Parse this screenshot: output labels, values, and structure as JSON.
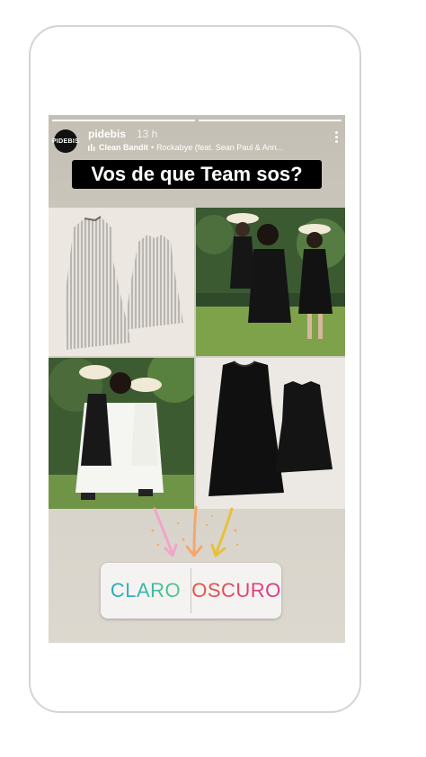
{
  "story": {
    "username": "pidebis",
    "time": "13 h",
    "avatar_text": "PIDEBIS",
    "music": {
      "artist": "Clean Bandit",
      "song": "Rockabye (feat. Sean Paul & Ann..."
    },
    "question": "Vos de que Team sos?",
    "poll": {
      "option_left": "CLARO",
      "option_right": "OSCURO"
    },
    "colors": {
      "claro_gradient": [
        "#2aa7c7",
        "#4cc98a"
      ],
      "oscuro_gradient": [
        "#e6563f",
        "#d9378b"
      ],
      "question_bg": "#000000"
    },
    "icons": [
      "music-bars-icon",
      "more-options-icon",
      "arrow-down-icon"
    ]
  }
}
